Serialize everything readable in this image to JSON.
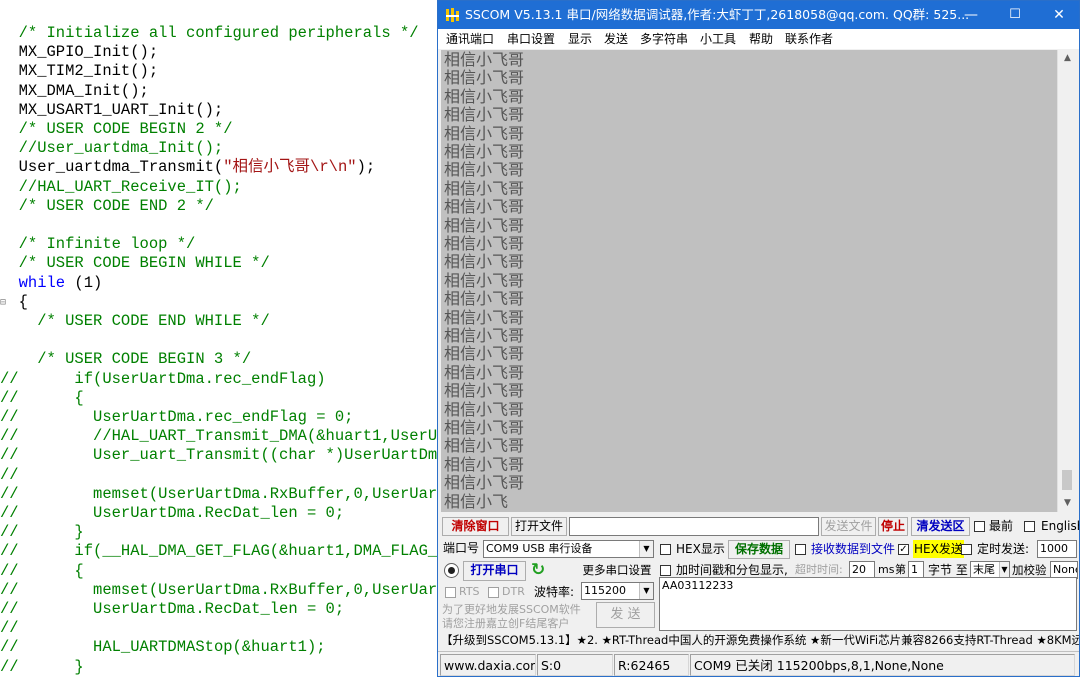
{
  "editor": {
    "fold_marker": "⊟",
    "lines": [
      {
        "segments": [
          {
            "t": "  /* Initialize all configured peripherals */",
            "c": "cm"
          }
        ]
      },
      {
        "segments": [
          {
            "t": "  MX_GPIO_Init();",
            "c": "tx"
          }
        ]
      },
      {
        "segments": [
          {
            "t": "  MX_TIM2_Init();",
            "c": "tx"
          }
        ]
      },
      {
        "segments": [
          {
            "t": "  MX_DMA_Init();",
            "c": "tx"
          }
        ]
      },
      {
        "segments": [
          {
            "t": "  MX_USART1_UART_Init();",
            "c": "tx"
          }
        ]
      },
      {
        "segments": [
          {
            "t": "  /* USER CODE BEGIN 2 */",
            "c": "cm"
          }
        ]
      },
      {
        "segments": [
          {
            "t": "  //User_uartdma_Init();",
            "c": "cm"
          }
        ]
      },
      {
        "segments": [
          {
            "t": "  User_uartdma_Transmit(",
            "c": "tx"
          },
          {
            "t": "\"相信小飞哥\\r\\n\"",
            "c": "st"
          },
          {
            "t": ");",
            "c": "tx"
          }
        ]
      },
      {
        "segments": [
          {
            "t": "  //HAL_UART_Receive_IT();",
            "c": "cm"
          }
        ]
      },
      {
        "segments": [
          {
            "t": "  /* USER CODE END 2 */",
            "c": "cm"
          }
        ]
      },
      {
        "segments": [
          {
            "t": "",
            "c": "tx"
          }
        ]
      },
      {
        "segments": [
          {
            "t": "  /* Infinite loop */",
            "c": "cm"
          }
        ]
      },
      {
        "segments": [
          {
            "t": "  /* USER CODE BEGIN WHILE */",
            "c": "cm"
          }
        ]
      },
      {
        "segments": [
          {
            "t": "  while",
            "c": "kw"
          },
          {
            "t": " (1)",
            "c": "tx"
          }
        ]
      },
      {
        "segments": [
          {
            "t": "  {",
            "c": "tx"
          }
        ]
      },
      {
        "segments": [
          {
            "t": "    /* USER CODE END WHILE */",
            "c": "cm"
          }
        ]
      },
      {
        "segments": [
          {
            "t": "",
            "c": "tx"
          }
        ]
      },
      {
        "segments": [
          {
            "t": "    /* USER CODE BEGIN 3 */",
            "c": "cm"
          }
        ]
      },
      {
        "segments": [
          {
            "t": "//",
            "c": "ac"
          },
          {
            "t": "      if(UserUartDma.rec_endFlag)",
            "c": "cm"
          }
        ]
      },
      {
        "segments": [
          {
            "t": "//",
            "c": "ac"
          },
          {
            "t": "      {",
            "c": "cm"
          }
        ]
      },
      {
        "segments": [
          {
            "t": "//",
            "c": "ac"
          },
          {
            "t": "        UserUartDma.rec_endFlag = 0;",
            "c": "cm"
          }
        ]
      },
      {
        "segments": [
          {
            "t": "//",
            "c": "ac"
          },
          {
            "t": "        //HAL_UART_Transmit_DMA(&huart1,UserU",
            "c": "cm"
          }
        ]
      },
      {
        "segments": [
          {
            "t": "//",
            "c": "ac"
          },
          {
            "t": "        User_uart_Transmit((char *)UserUartDm",
            "c": "cm"
          }
        ]
      },
      {
        "segments": [
          {
            "t": "//",
            "c": "ac"
          }
        ]
      },
      {
        "segments": [
          {
            "t": "//",
            "c": "ac"
          },
          {
            "t": "        memset(UserUartDma.RxBuffer,0,UserUar",
            "c": "cm"
          }
        ]
      },
      {
        "segments": [
          {
            "t": "//",
            "c": "ac"
          },
          {
            "t": "        UserUartDma.RecDat_len = 0;",
            "c": "cm"
          }
        ]
      },
      {
        "segments": [
          {
            "t": "//",
            "c": "ac"
          },
          {
            "t": "      }",
            "c": "cm"
          }
        ]
      },
      {
        "segments": [
          {
            "t": "//",
            "c": "ac"
          },
          {
            "t": "      if(__HAL_DMA_GET_FLAG(&huart1,DMA_FLAG_",
            "c": "cm"
          }
        ]
      },
      {
        "segments": [
          {
            "t": "//",
            "c": "ac"
          },
          {
            "t": "      {",
            "c": "cm"
          }
        ]
      },
      {
        "segments": [
          {
            "t": "//",
            "c": "ac"
          },
          {
            "t": "        memset(UserUartDma.RxBuffer,0,UserUar",
            "c": "cm"
          }
        ]
      },
      {
        "segments": [
          {
            "t": "//",
            "c": "ac"
          },
          {
            "t": "        UserUartDma.RecDat_len = 0;",
            "c": "cm"
          }
        ]
      },
      {
        "segments": [
          {
            "t": "//",
            "c": "ac"
          }
        ]
      },
      {
        "segments": [
          {
            "t": "//",
            "c": "ac"
          },
          {
            "t": "        HAL_UARTDMAStop(&huart1);",
            "c": "cm"
          }
        ]
      },
      {
        "segments": [
          {
            "t": "//",
            "c": "ac"
          },
          {
            "t": "      }",
            "c": "cm"
          }
        ]
      }
    ]
  },
  "sscom": {
    "title": "SSCOM V5.13.1 串口/网络数据调试器,作者:大虾丁丁,2618058@qq.com. QQ群: 525...",
    "window_buttons": {
      "minimize": "—",
      "maximize": "☐",
      "close": "✕"
    },
    "menu": [
      "通讯端口",
      "串口设置",
      "显示",
      "发送",
      "多字符串",
      "小工具",
      "帮助",
      "联系作者"
    ],
    "receive": {
      "full_line": "相信小飞哥",
      "full_line_count": 24,
      "last_line": "相信小飞"
    },
    "toolbar": {
      "clear_window": "清除窗口",
      "open_file": "打开文件",
      "file_path": "",
      "send_file": "发送文件",
      "stop": "停止",
      "clear_send": "清发送区",
      "top_most_label": "最前",
      "top_most_checked": false,
      "english_label": "English",
      "english_checked": false
    },
    "port": {
      "label": "端口号",
      "value": "COM9 USB 串行设备",
      "more_settings": "更多串口设置",
      "open_button": "打开串口",
      "refresh_icon": "↻",
      "rts_label": "RTS",
      "dtr_label": "DTR",
      "baud_label": "波特率:",
      "baud_value": "115200"
    },
    "options": {
      "hex_display": "HEX显示",
      "hex_display_checked": false,
      "save_data": "保存数据",
      "recv_to_file": "接收数据到文件",
      "recv_to_file_checked": false,
      "hex_send": "HEX发送",
      "hex_send_checked": true,
      "timed_send": "定时发送:",
      "timed_send_checked": false,
      "timed_value": "1000",
      "timestamp": "加时间戳和分包显示,",
      "timestamp_checked": false,
      "timeout_label": "超时时间:",
      "timeout_value": "20",
      "ms_label": "ms",
      "page_label": "第",
      "page_value": "1",
      "byte_label": "字节 至",
      "end_value": "末尾",
      "checksum_label": "加校验",
      "checksum_value": "None"
    },
    "promo": "为了更好地发展SSCOM软件\n请您注册嘉立创F结尾客户",
    "send_button": "发 送",
    "send_text": "AA03112233",
    "marquee": "【升级到SSCOM5.13.1】★2. ★RT-Thread中国人的开源免费操作系统 ★新一代WiFi芯片兼容8266支持RT-Thread ★8KM远",
    "status": {
      "site": "www.daxia.com",
      "sent": "S:0",
      "received": "R:62465",
      "port_state": "COM9 已关闭  115200bps,8,1,None,None"
    }
  }
}
